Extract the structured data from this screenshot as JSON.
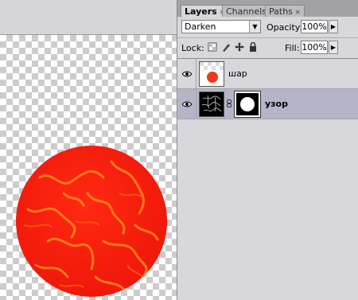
{
  "panel": {
    "tabs": [
      {
        "label": "Layers",
        "active": true
      },
      {
        "label": "Channels",
        "active": false
      },
      {
        "label": "Paths",
        "active": false
      }
    ],
    "blend_mode": "Darken",
    "opacity_label": "Opacity:",
    "opacity_value": "100%",
    "lock_label": "Lock:",
    "fill_label": "Fill:",
    "fill_value": "100%",
    "layers": [
      {
        "name": "шар",
        "selected": false,
        "visible": true
      },
      {
        "name": "узор",
        "selected": true,
        "visible": true
      }
    ]
  },
  "colors": {
    "sphere": "#f31c0c",
    "pattern": "#ff8a1e",
    "panel_bg": "#d8d7dc",
    "selected_row": "#b4b6c8"
  },
  "icons": [
    "eye-icon",
    "link-icon",
    "lock-transparent-icon",
    "lock-paint-icon",
    "lock-move-icon",
    "lock-all-icon",
    "dropdown-arrow-icon",
    "flyout-arrow-icon",
    "tab-close-icon"
  ]
}
